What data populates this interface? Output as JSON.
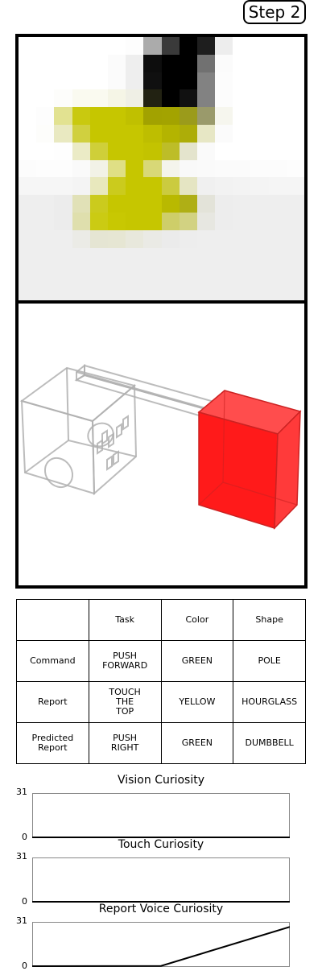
{
  "step_label": "Step 2",
  "vision_pixels": [
    [
      "#ffffff",
      "#ffffff",
      "#ffffff",
      "#ffffff",
      "#ffffff",
      "#ffffff",
      "#fdfdfd",
      "#ababab",
      "#3a3a3a",
      "#000000",
      "#1e1e1e",
      "#ededed",
      "#ffffff",
      "#ffffff",
      "#ffffff",
      "#ffffff"
    ],
    [
      "#ffffff",
      "#ffffff",
      "#ffffff",
      "#ffffff",
      "#ffffff",
      "#fbfbfb",
      "#eeeeee",
      "#0d0d0d",
      "#000000",
      "#000000",
      "#717171",
      "#fbfbfb",
      "#ffffff",
      "#ffffff",
      "#ffffff",
      "#ffffff"
    ],
    [
      "#ffffff",
      "#ffffff",
      "#ffffff",
      "#ffffff",
      "#ffffff",
      "#fbfbfb",
      "#eeeeee",
      "#101010",
      "#000000",
      "#000000",
      "#828282",
      "#fcfcfc",
      "#ffffff",
      "#ffffff",
      "#ffffff",
      "#ffffff"
    ],
    [
      "#ffffff",
      "#ffffff",
      "#fdfdfb",
      "#fafaf0",
      "#fafaf0",
      "#f5f5e6",
      "#efefe5",
      "#222212",
      "#000000",
      "#111111",
      "#828282",
      "#fcfcfc",
      "#ffffff",
      "#ffffff",
      "#ffffff",
      "#ffffff"
    ],
    [
      "#ffffff",
      "#fdfdfd",
      "#e2e291",
      "#c9c90f",
      "#c6c600",
      "#c6c600",
      "#c0c000",
      "#a2a200",
      "#a3a300",
      "#9b9b1b",
      "#9a9a6b",
      "#f6f6ee",
      "#ffffff",
      "#ffffff",
      "#ffffff",
      "#ffffff"
    ],
    [
      "#ffffff",
      "#fdfdfb",
      "#e9e9c1",
      "#d0d03f",
      "#c6c600",
      "#c6c600",
      "#c6c600",
      "#bebe00",
      "#b4b400",
      "#adad08",
      "#e7e7c5",
      "#fbfbfb",
      "#ffffff",
      "#ffffff",
      "#ffffff",
      "#ffffff"
    ],
    [
      "#ffffff",
      "#ffffff",
      "#fefefe",
      "#ebebc6",
      "#cfcf39",
      "#c6c600",
      "#c6c600",
      "#c3c300",
      "#bdbd28",
      "#e4e4cd",
      "#fafafa",
      "#ffffff",
      "#ffffff",
      "#ffffff",
      "#ffffff",
      "#ffffff"
    ],
    [
      "#fcfcfc",
      "#fdfdfd",
      "#fdfdfd",
      "#fafafa",
      "#f2f2e7",
      "#dfdf85",
      "#c6c600",
      "#d8d877",
      "#f4f4ec",
      "#f9f9f9",
      "#fafafa",
      "#fbfbfb",
      "#fbfbfb",
      "#fcfcfc",
      "#fcfcfc",
      "#fdfdfd"
    ],
    [
      "#f6f6f6",
      "#f6f6f6",
      "#f6f6f6",
      "#f4f4f4",
      "#e8e8bd",
      "#cbcb1d",
      "#c6c600",
      "#c6c600",
      "#cbcb3f",
      "#e5e5c3",
      "#f0f0f0",
      "#f2f2f2",
      "#f3f3f3",
      "#f4f4f4",
      "#f5f5f5",
      "#f5f5f5"
    ],
    [
      "#eeeeee",
      "#eeeeee",
      "#ececec",
      "#e1e1b7",
      "#cbcb1d",
      "#c6c600",
      "#c6c600",
      "#c6c600",
      "#b9b900",
      "#afaf15",
      "#e3e3d9",
      "#ededed",
      "#eeeeee",
      "#eeeeee",
      "#eeeeee",
      "#eeeeee"
    ],
    [
      "#eeeeee",
      "#eeeeee",
      "#ececec",
      "#dfdfad",
      "#cbcb13",
      "#c8c802",
      "#c6c600",
      "#c6c600",
      "#cece69",
      "#d2d282",
      "#e7e7e1",
      "#ededed",
      "#eeeeee",
      "#eeeeee",
      "#eeeeee",
      "#eeeeee"
    ],
    [
      "#eeeeee",
      "#eeeeee",
      "#eeeeee",
      "#ebebe6",
      "#e5e5d3",
      "#e6e6d3",
      "#e8e8dc",
      "#eaeae5",
      "#ebebeb",
      "#ededed",
      "#eeeeee",
      "#eeeeee",
      "#eeeeee",
      "#eeeeee",
      "#eeeeee",
      "#eeeeee"
    ],
    [
      "#eeeeee",
      "#eeeeee",
      "#eeeeee",
      "#eeeeee",
      "#eeeeee",
      "#eeeeee",
      "#eeeeee",
      "#eeeeee",
      "#eeeeee",
      "#eeeeee",
      "#eeeeee",
      "#eeeeee",
      "#eeeeee",
      "#eeeeee",
      "#eeeeee",
      "#eeeeee"
    ],
    [
      "#eeeeee",
      "#eeeeee",
      "#eeeeee",
      "#eeeeee",
      "#eeeeee",
      "#eeeeee",
      "#eeeeee",
      "#eeeeee",
      "#eeeeee",
      "#eeeeee",
      "#eeeeee",
      "#eeeeee",
      "#eeeeee",
      "#eeeeee",
      "#eeeeee",
      "#eeeeee"
    ],
    [
      "#eeeeee",
      "#eeeeee",
      "#eeeeee",
      "#eeeeee",
      "#eeeeee",
      "#eeeeee",
      "#eeeeee",
      "#eeeeee",
      "#eeeeee",
      "#eeeeee",
      "#eeeeee",
      "#eeeeee",
      "#eeeeee",
      "#eeeeee",
      "#eeeeee",
      "#eeeeee"
    ]
  ],
  "scene": {
    "target_block_color": "#ff1a1a",
    "wireframe_color": "#b0b0b0"
  },
  "report_table": {
    "headers": [
      "",
      "Task",
      "Color",
      "Shape"
    ],
    "rows": [
      {
        "label": "Command",
        "task": "PUSH\nFORWARD",
        "color": "GREEN",
        "shape": "POLE"
      },
      {
        "label": "Report",
        "task": "TOUCH\nTHE\nTOP",
        "color": "YELLOW",
        "shape": "HOURGLASS"
      },
      {
        "label": "Predicted\nReport",
        "task": "PUSH\nRIGHT",
        "color": "GREEN",
        "shape": "DUMBBELL"
      }
    ]
  },
  "curiosity": [
    {
      "title": "Vision Curiosity",
      "ymax": "31",
      "ymin": "0",
      "values": [
        0,
        0,
        0
      ]
    },
    {
      "title": "Touch Curiosity",
      "ymax": "31",
      "ymin": "0",
      "values": [
        0,
        0,
        0
      ]
    },
    {
      "title": "Report Voice Curiosity",
      "ymax": "31",
      "ymin": "0",
      "values": [
        0,
        0.2,
        28
      ]
    }
  ]
}
